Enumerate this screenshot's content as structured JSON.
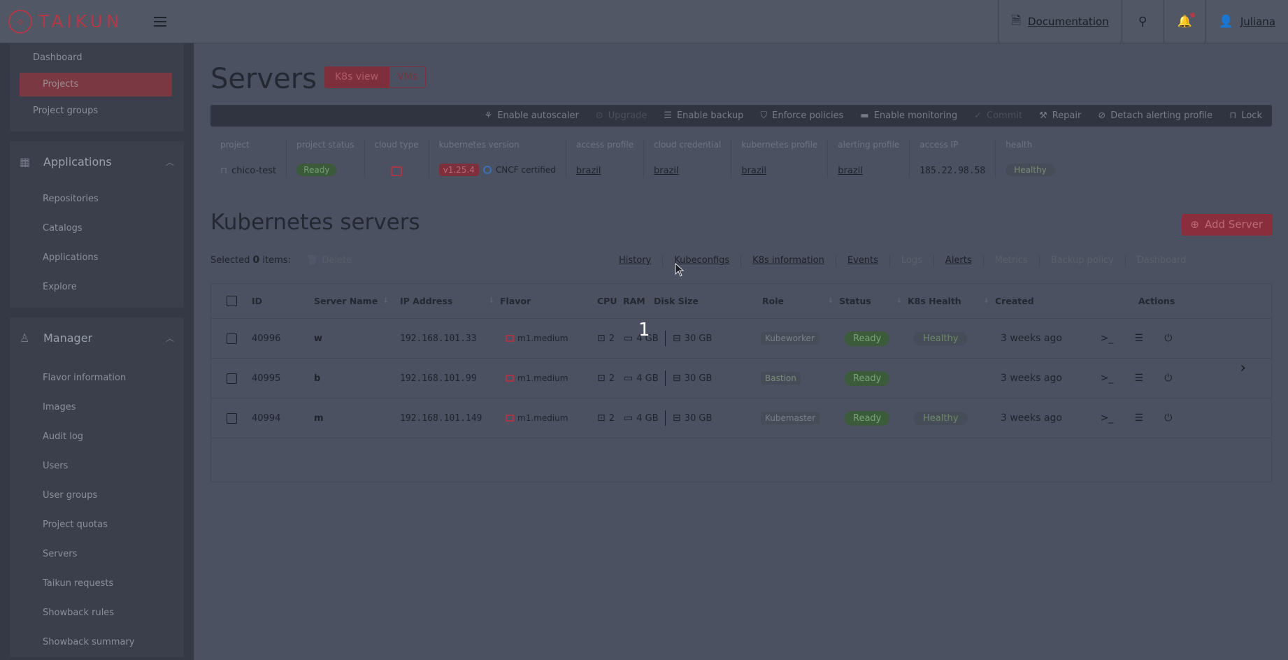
{
  "brand": {
    "name": "TAIKUN"
  },
  "topbar": {
    "documentation": "Documentation",
    "user": "Juliana"
  },
  "sidebar": {
    "top_items": [
      "Dashboard",
      "Projects",
      "Project groups"
    ],
    "applications": {
      "title": "Applications",
      "items": [
        "Repositories",
        "Catalogs",
        "Applications",
        "Explore"
      ]
    },
    "manager": {
      "title": "Manager",
      "items": [
        "Flavor information",
        "Images",
        "Audit log",
        "Users",
        "User groups",
        "Project quotas",
        "Servers",
        "Taikun requests",
        "Showback rules",
        "Showback summary"
      ]
    }
  },
  "page": {
    "title": "Servers",
    "k8s_view": "K8s view",
    "vms": "VMs"
  },
  "actionbar": [
    {
      "label": "Enable autoscaler",
      "icon": "autoscaler-icon",
      "disabled": false
    },
    {
      "label": "Upgrade",
      "icon": "upgrade-icon",
      "disabled": true
    },
    {
      "label": "Enable backup",
      "icon": "backup-icon",
      "disabled": false
    },
    {
      "label": "Enforce policies",
      "icon": "policy-icon",
      "disabled": false
    },
    {
      "label": "Enable monitoring",
      "icon": "monitoring-icon",
      "disabled": false
    },
    {
      "label": "Commit",
      "icon": "commit-icon",
      "disabled": true
    },
    {
      "label": "Repair",
      "icon": "repair-icon",
      "disabled": false
    },
    {
      "label": "Detach alerting profile",
      "icon": "detach-icon",
      "disabled": false
    },
    {
      "label": "Lock",
      "icon": "lock-icon",
      "disabled": false
    }
  ],
  "info": {
    "project": {
      "label": "project",
      "value": "chico-test"
    },
    "project_status": {
      "label": "project status",
      "value": "Ready"
    },
    "cloud_type": {
      "label": "cloud type"
    },
    "kubernetes_version": {
      "label": "kubernetes version",
      "version": "v1.25.4",
      "cncf": "CNCF certified"
    },
    "access_profile": {
      "label": "access profile",
      "value": "brazil"
    },
    "cloud_credential": {
      "label": "cloud credential",
      "value": "brazil"
    },
    "kubernetes_profile": {
      "label": "kubernetes profile",
      "value": "brazil"
    },
    "alerting_profile": {
      "label": "alerting profile",
      "value": "brazil"
    },
    "access_ip": {
      "label": "access IP",
      "value": "185.22.98.58"
    },
    "health": {
      "label": "health",
      "value": "Healthy"
    }
  },
  "section": {
    "title": "Kubernetes servers",
    "add_button": "Add Server"
  },
  "selection": {
    "prefix": "Selected",
    "count": "0",
    "suffix": "items:",
    "delete": "Delete"
  },
  "tabs": [
    {
      "label": "History",
      "disabled": false
    },
    {
      "label": "Kubeconfigs",
      "disabled": false
    },
    {
      "label": "K8s information",
      "disabled": false
    },
    {
      "label": "Events",
      "disabled": false
    },
    {
      "label": "Logs",
      "disabled": true
    },
    {
      "label": "Alerts",
      "disabled": false
    },
    {
      "label": "Metrics",
      "disabled": true
    },
    {
      "label": "Backup policy",
      "disabled": true
    },
    {
      "label": "Dashboard",
      "disabled": true
    }
  ],
  "table": {
    "headers": {
      "id": "ID",
      "name": "Server Name",
      "ip": "IP Address",
      "flavor": "Flavor",
      "cpu": "CPU",
      "ram": "RAM",
      "disk": "Disk Size",
      "role": "Role",
      "status": "Status",
      "health": "K8s Health",
      "created": "Created",
      "actions": "Actions"
    },
    "rows": [
      {
        "id": "40996",
        "name": "w",
        "ip": "192.168.101.33",
        "flavor": "m1.medium",
        "cpu": "2",
        "ram": "4 GB",
        "disk": "30 GB",
        "role": "Kubeworker",
        "status": "Ready",
        "health": "Healthy",
        "created": "3 weeks ago"
      },
      {
        "id": "40995",
        "name": "b",
        "ip": "192.168.101.99",
        "flavor": "m1.medium",
        "cpu": "2",
        "ram": "4 GB",
        "disk": "30 GB",
        "role": "Bastion",
        "status": "Ready",
        "health": "",
        "created": "3 weeks ago"
      },
      {
        "id": "40994",
        "name": "m",
        "ip": "192.168.101.149",
        "flavor": "m1.medium",
        "cpu": "2",
        "ram": "4 GB",
        "disk": "30 GB",
        "role": "Kubemaster",
        "status": "Ready",
        "health": "Healthy",
        "created": "3 weeks ago"
      }
    ]
  },
  "overlay": {
    "step_number": "1"
  },
  "colors": {
    "accent": "#b03a48",
    "ready": "#3b5b3b",
    "overlay_bg": "#4b5160"
  }
}
